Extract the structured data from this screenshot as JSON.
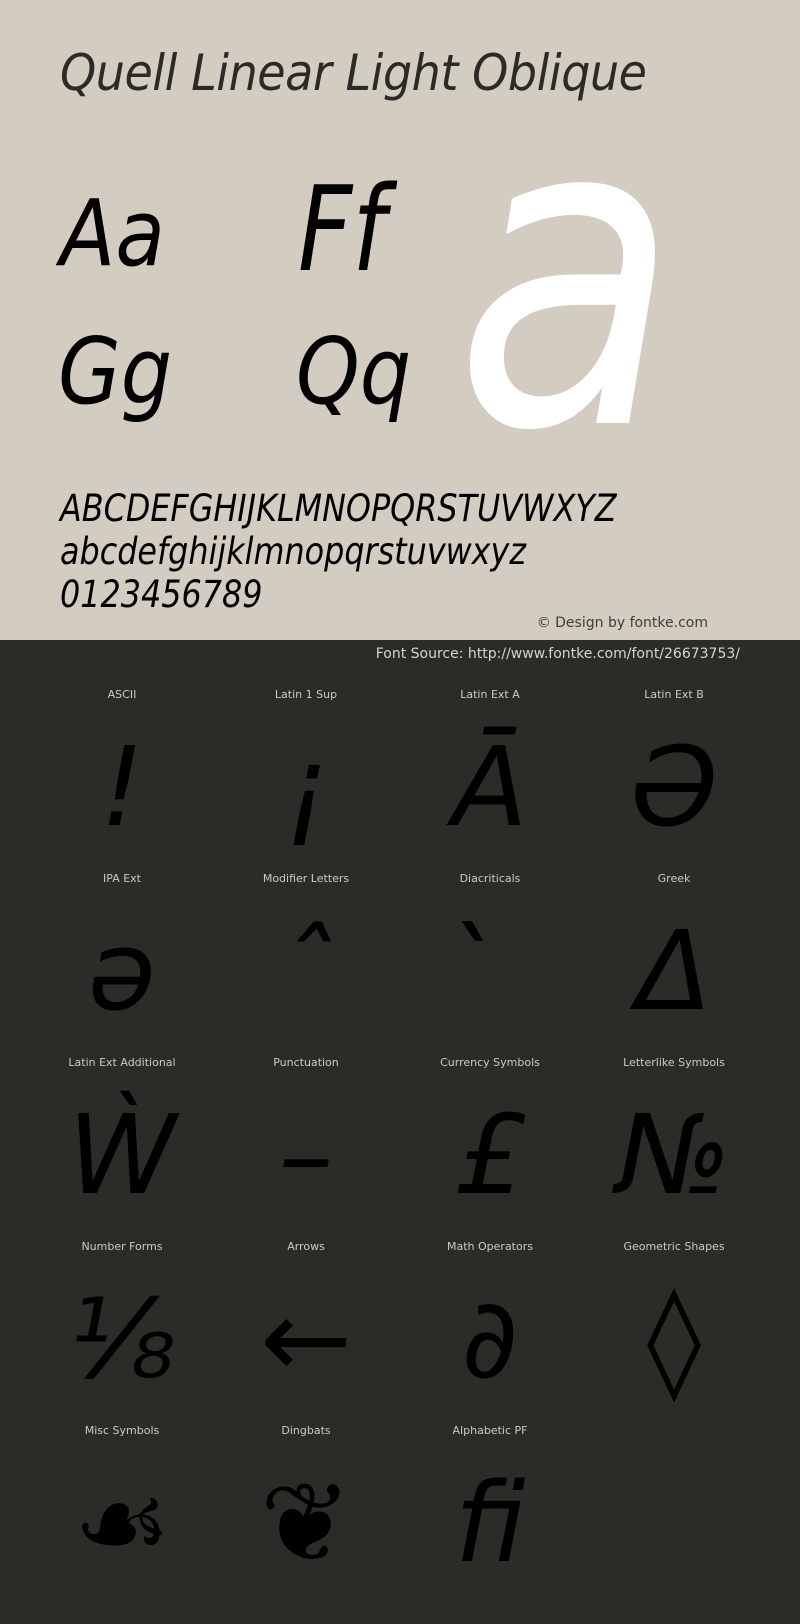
{
  "header": {
    "font_name": "Quell Linear Light Oblique"
  },
  "specimen": {
    "pairs": [
      "Aa",
      "Ff",
      "Gg",
      "Qq"
    ],
    "hero_glyph": "a",
    "uppercase": "ABCDEFGHIJKLMNOPQRSTUVWXYZ",
    "lowercase": "abcdefghijklmnopqrstuvwxyz",
    "digits": "0123456789",
    "credit": "© Design by fontke.com",
    "hero_color": "#ffffff",
    "background_color": "#d2ccc1"
  },
  "source": {
    "label": "Font Source: http://www.fontke.com/font/26673753/"
  },
  "blocks": [
    {
      "label": "ASCII",
      "glyph": "!"
    },
    {
      "label": "Latin 1 Sup",
      "glyph": "¡"
    },
    {
      "label": "Latin Ext A",
      "glyph": "Ā"
    },
    {
      "label": "Latin Ext B",
      "glyph": "Ə"
    },
    {
      "label": "IPA Ext",
      "glyph": "ə"
    },
    {
      "label": "Modifier Letters",
      "glyph": "ˆ"
    },
    {
      "label": "Diacriticals",
      "glyph": "̀"
    },
    {
      "label": "Greek",
      "glyph": "Δ"
    },
    {
      "label": "Latin Ext Additional",
      "glyph": "Ẁ"
    },
    {
      "label": "Punctuation",
      "glyph": "–"
    },
    {
      "label": "Currency Symbols",
      "glyph": "£"
    },
    {
      "label": "Letterlike Symbols",
      "glyph": "№"
    },
    {
      "label": "Number Forms",
      "glyph": "⅛"
    },
    {
      "label": "Arrows",
      "glyph": "←"
    },
    {
      "label": "Math Operators",
      "glyph": "∂"
    },
    {
      "label": "Geometric Shapes",
      "glyph": "◊"
    },
    {
      "label": "Misc Symbols",
      "glyph": "☙"
    },
    {
      "label": "Dingbats",
      "glyph": "❦"
    },
    {
      "label": "Alphabetic PF",
      "glyph": "ﬁ"
    }
  ],
  "colors": {
    "panel_light": "#d2ccc1",
    "panel_dark": "#2b2b28",
    "glyph": "#000000",
    "label": "#cfcac0"
  }
}
